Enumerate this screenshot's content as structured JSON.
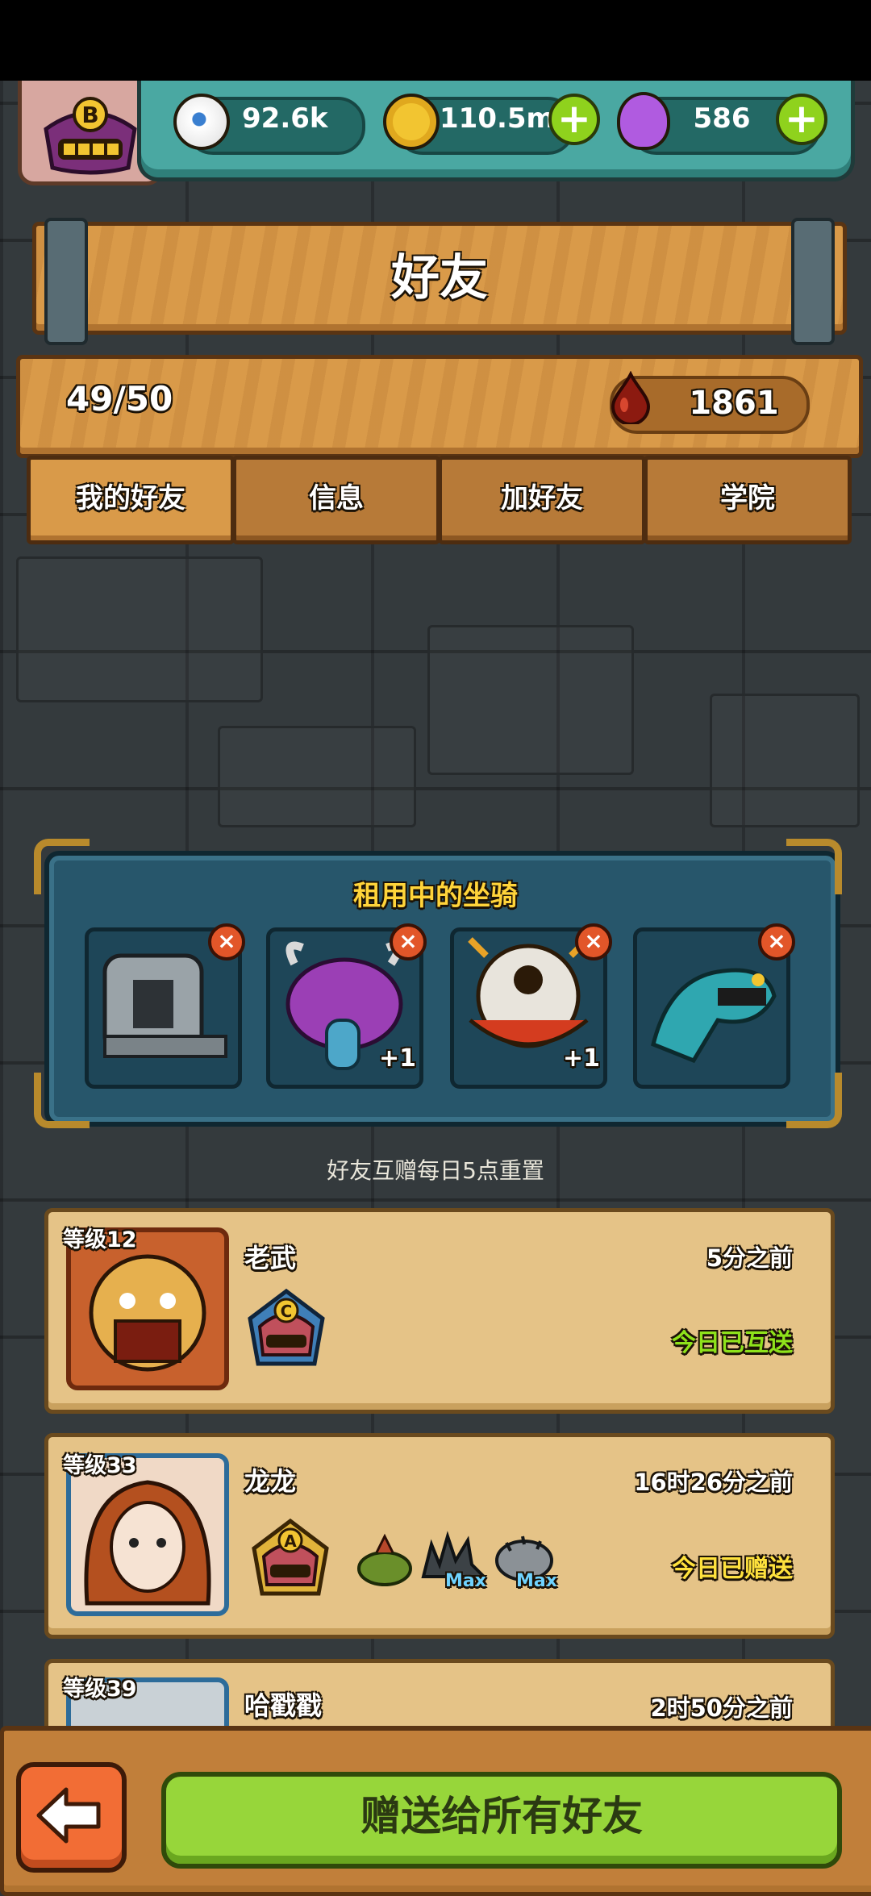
{
  "header": {
    "eyeballs": "92.6k",
    "coins": "110.5m",
    "potions": "586",
    "player_rank": "B"
  },
  "title": "好友",
  "friend_count": "49/50",
  "blood": "1861",
  "tabs": [
    {
      "label": "我的好友",
      "active": true
    },
    {
      "label": "信息",
      "active": false
    },
    {
      "label": "加好友",
      "active": false
    },
    {
      "label": "学院",
      "active": false
    }
  ],
  "mounts": {
    "title": "租用中的坐骑",
    "slots": [
      {
        "icon": "mech-skull-mount-icon",
        "plus": ""
      },
      {
        "icon": "purple-demon-mount-icon",
        "plus": "+1"
      },
      {
        "icon": "lion-dance-mount-icon",
        "plus": "+1"
      },
      {
        "icon": "cyan-dragon-mount-icon",
        "plus": ""
      }
    ]
  },
  "reset_note": "好友互赠每日5点重置",
  "friends": [
    {
      "level": "等级12",
      "name": "老武",
      "time": "5分之前",
      "status": "今日已互送",
      "rank": "C",
      "status_color": "#8ee21b",
      "pets": []
    },
    {
      "level": "等级33",
      "name": "龙龙",
      "time": "16时26分之前",
      "status": "今日已赠送",
      "rank": "A",
      "status_color": "#ffe23d",
      "pets": [
        "",
        "Max",
        "Max"
      ]
    },
    {
      "level": "等级39",
      "name": "哈戳戳",
      "time": "2时50分之前",
      "status": "",
      "rank": "",
      "pets": []
    }
  ],
  "bottom": {
    "send_all": "赠送给所有好友"
  },
  "colors": {
    "accent_green": "#97d63a",
    "wood": "#d99a49",
    "mounts_panel": "#27566b",
    "card": "#e5c387"
  }
}
